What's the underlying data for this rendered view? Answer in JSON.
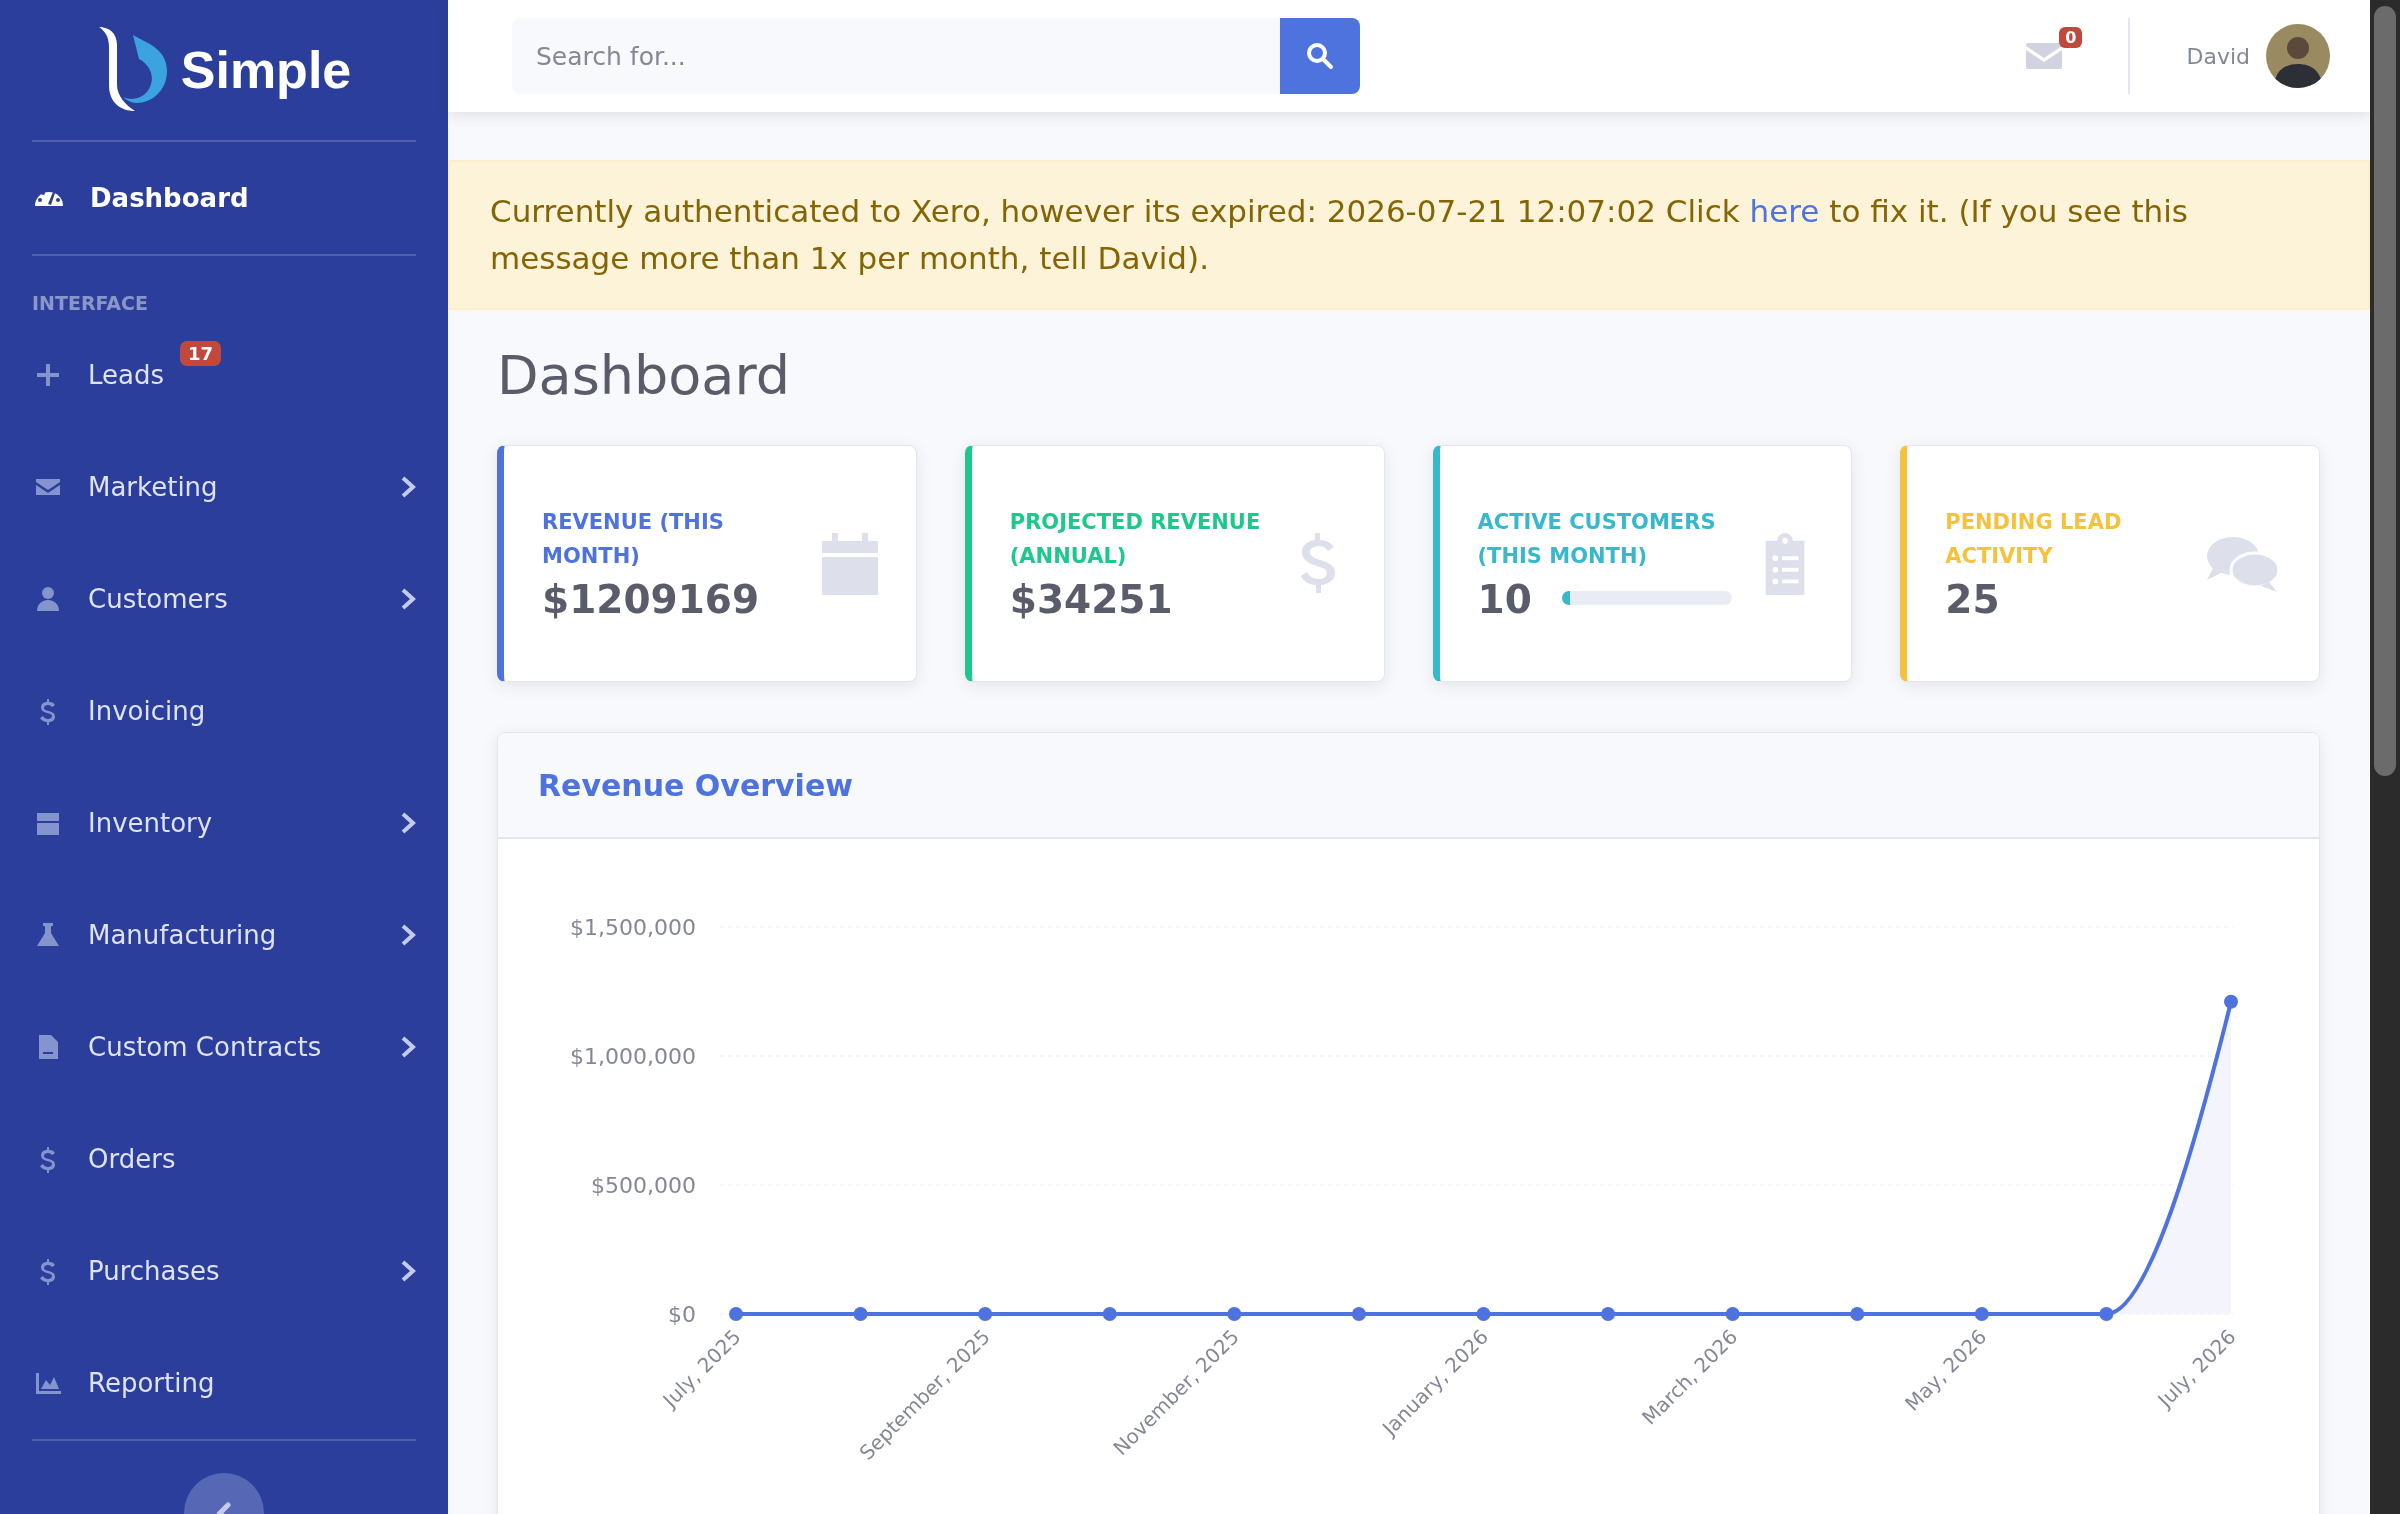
{
  "sidebar": {
    "logo_text": "Simple",
    "dashboard": {
      "label": "Dashboard",
      "selected": true
    },
    "heading": "INTERFACE",
    "items": [
      {
        "label": "Leads",
        "kind": "link",
        "badge": "17",
        "selected": false
      },
      {
        "label": "Marketing",
        "kind": "group",
        "selected": false
      },
      {
        "label": "Customers",
        "kind": "group",
        "selected": false
      },
      {
        "label": "Invoicing",
        "kind": "link",
        "selected": false
      },
      {
        "label": "Inventory",
        "kind": "group",
        "selected": false
      },
      {
        "label": "Manufacturing",
        "kind": "group",
        "selected": false
      },
      {
        "label": "Custom Contracts",
        "kind": "group",
        "selected": false
      },
      {
        "label": "Orders",
        "kind": "link",
        "selected": false
      },
      {
        "label": "Purchases",
        "kind": "group",
        "selected": false
      },
      {
        "label": "Reporting",
        "kind": "link",
        "selected": false
      }
    ]
  },
  "topbar": {
    "search": {
      "placeholder": "Search for..."
    },
    "messages_badge": "0",
    "user_name": "David"
  },
  "alert": {
    "text_before": "Currently authenticated to Xero, however its expired: 2026-07-21 12:07:02 Click ",
    "link": "here",
    "text_after": " to fix it. (If you see this message more than 1x per month, tell David)."
  },
  "page_title": "Dashboard",
  "cards": [
    {
      "label": "REVENUE (THIS MONTH)",
      "value": "$1209169",
      "color": "#4e73df"
    },
    {
      "label": "PROJECTED REVENUE (ANNUAL)",
      "value": "$34251",
      "color": "#1cc88a"
    },
    {
      "label": "ACTIVE CUSTOMERS (THIS MONTH)",
      "value": "10",
      "color": "#36b9cc",
      "level": 0.05
    },
    {
      "label": "PENDING LEAD ACTIVITY",
      "value": "25",
      "color": "#f6c23e"
    }
  ],
  "revenue_overview": {
    "title": "Revenue Overview",
    "chart_data": {
      "type": "line",
      "categories": [
        "July, 2025",
        null,
        "September, 2025",
        null,
        "November, 2025",
        null,
        "January, 2026",
        null,
        "March, 2026",
        null,
        "May, 2026",
        null,
        "July, 2026"
      ],
      "series": [
        {
          "color": "#4e73df",
          "marker": true,
          "values": [
            0,
            0,
            0,
            0,
            0,
            0,
            0,
            0,
            0,
            0,
            0,
            0,
            1210000
          ]
        }
      ],
      "ylim": [
        0,
        1500000
      ],
      "yticks": [
        {
          "value": 0,
          "label": "$0"
        },
        {
          "value": 500000,
          "label": "$500,000"
        },
        {
          "value": 1000000,
          "label": "$1,000,000"
        },
        {
          "value": 1500000,
          "label": "$1,500,000"
        }
      ]
    }
  }
}
